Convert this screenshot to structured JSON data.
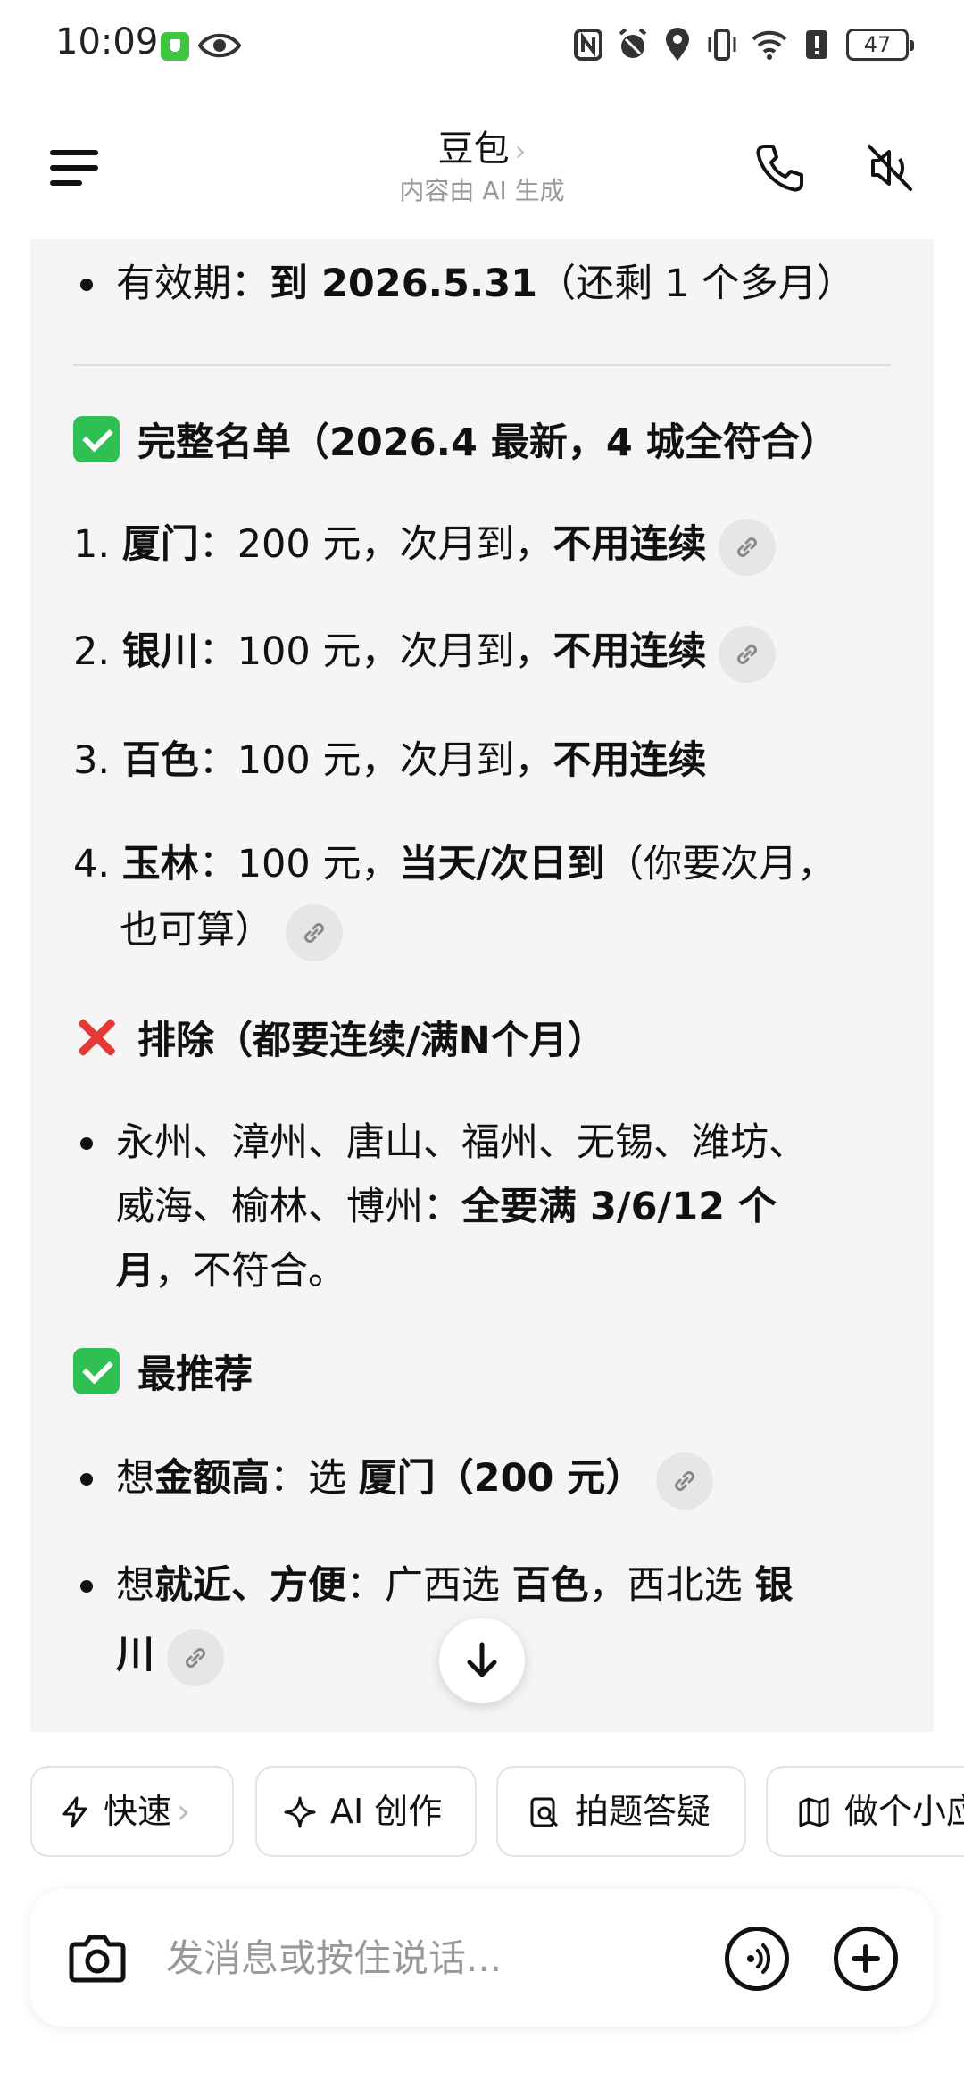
{
  "status_bar": {
    "time": "10:09",
    "battery": "47",
    "icons": [
      "shield-app-icon",
      "eye-icon",
      "nfc-icon",
      "alarm-icon",
      "location-icon",
      "vibrate-icon",
      "wifi-icon",
      "alert-icon",
      "battery-icon"
    ]
  },
  "header": {
    "title": "豆包",
    "title_chevron": "›",
    "subtitle": "内容由 AI 生成"
  },
  "message": {
    "validity": {
      "label": "有效期：",
      "value": "到 2026.5.31",
      "note": "（还剩 1 个多月）"
    },
    "full_list": {
      "heading": "完整名单（2026.4 最新，4 城全符合）",
      "items": [
        {
          "num": "1.",
          "city": "厦门",
          "text": "：200 元，次月到，",
          "bold": "不用连续",
          "has_link": true
        },
        {
          "num": "2.",
          "city": "银川",
          "text": "：100 元，次月到，",
          "bold": "不用连续",
          "has_link": true
        },
        {
          "num": "3.",
          "city": "百色",
          "text": "：100 元，次月到，",
          "bold": "不用连续",
          "has_link": false
        },
        {
          "num": "4.",
          "city": "玉林",
          "text": "：100 元，",
          "bold": "当天/次日到",
          "tail": "（你要次月，",
          "line2": "也可算）",
          "has_link": true
        }
      ]
    },
    "excluded": {
      "heading": "排除（都要连续/满N个月）",
      "line1": "永州、漳州、唐山、福州、无锡、潍坊、",
      "line2_a": "威海、榆林、博州：",
      "line2_b": "全要满 3/6/12 个",
      "line3_a": "月",
      "line3_b": "，不符合。"
    },
    "recommend": {
      "heading": "最推荐",
      "item1": {
        "a": "想",
        "b": "金额高",
        "c": "：选 ",
        "d": "厦门（200 元）"
      },
      "item2": {
        "a": "想",
        "b": "就近、方便",
        "c": "：广西选 ",
        "d": "百色",
        "e": "，西北选 ",
        "f": "银",
        "g": "川"
      }
    }
  },
  "chips": [
    {
      "label": "快速",
      "chevron": "›",
      "icon": "lightning-icon"
    },
    {
      "label": "AI 创作",
      "icon": "sparkle-icon"
    },
    {
      "label": "拍题答疑",
      "icon": "photo-question-icon"
    },
    {
      "label": "做个小应",
      "icon": "map-icon"
    }
  ],
  "input": {
    "placeholder": "发消息或按住说话..."
  },
  "colors": {
    "card_bg": "#f5f5f5",
    "check_green": "#2fbf53",
    "cross_red": "#e53935"
  }
}
